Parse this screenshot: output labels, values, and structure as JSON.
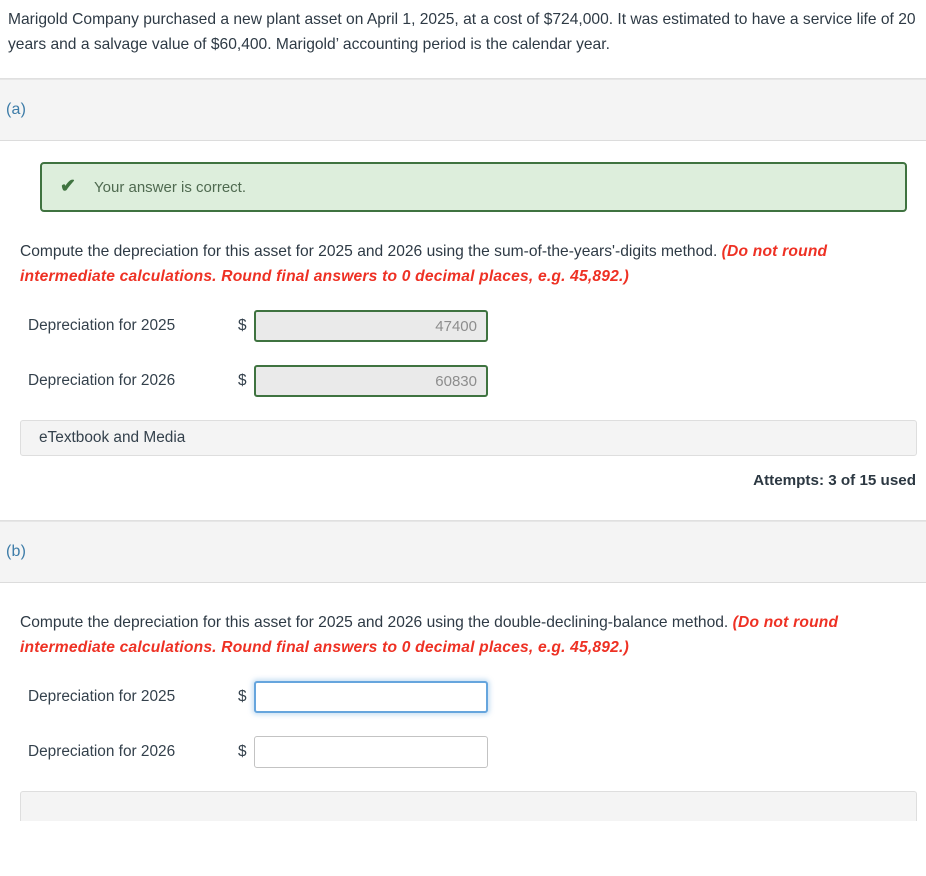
{
  "problem": {
    "statement": "Marigold Company purchased a new plant asset on April 1, 2025, at a cost of $724,000. It was estimated to have a service life of 20 years and a salvage value of $60,400. Marigold’ accounting period is the calendar year."
  },
  "colors": {
    "accent_blue": "#3d7ca8",
    "success_green": "#3f7340",
    "success_bg": "#ddeedc",
    "emphasis_red": "#ee3124",
    "focus_blue": "#66a5dd",
    "band_gray": "#f4f4f4",
    "text": "#34414c"
  },
  "parts": [
    {
      "letter": "(a)",
      "alert": {
        "icon": "check-icon",
        "glyph": "✔",
        "text": "Your answer is correct."
      },
      "instruction_plain": "Compute the depreciation for this asset for 2025 and 2026 using the sum-of-the-years'-digits method. ",
      "instruction_emphasis": "(Do not round intermediate calculations. Round final answers to 0 decimal places, e.g. 45,892.)",
      "rows": [
        {
          "label": "Depreciation for 2025",
          "currency": "$",
          "value": "47400",
          "placeholder": ""
        },
        {
          "label": "Depreciation for 2026",
          "currency": "$",
          "value": "60830",
          "placeholder": ""
        }
      ],
      "etextbook_label": "eTextbook and Media",
      "attempts": "Attempts: 3 of 15 used"
    },
    {
      "letter": "(b)",
      "instruction_plain": "Compute the depreciation for this asset for 2025 and 2026 using the double-declining-balance method. ",
      "instruction_emphasis": "(Do not round intermediate calculations. Round final answers to 0 decimal places, e.g. 45,892.)",
      "rows": [
        {
          "label": "Depreciation for 2025",
          "currency": "$",
          "value": "",
          "placeholder": ""
        },
        {
          "label": "Depreciation for 2026",
          "currency": "$",
          "value": "",
          "placeholder": ""
        }
      ],
      "etextbook_label": ""
    }
  ]
}
